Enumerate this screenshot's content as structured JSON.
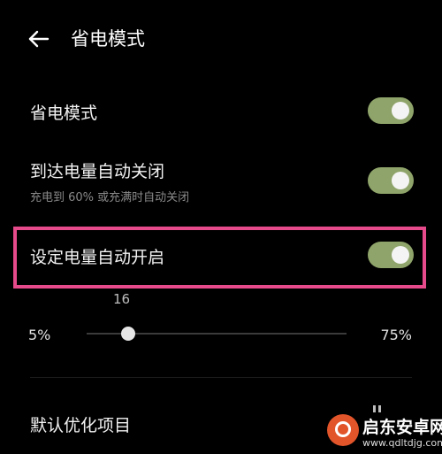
{
  "header": {
    "title": "省电模式"
  },
  "settings": [
    {
      "label": "省电模式",
      "toggle_on": true
    },
    {
      "label": "到达电量自动关闭",
      "sub": "充电到 60% 或充满时自动关闭",
      "toggle_on": true
    },
    {
      "label": "设定电量自动开启",
      "toggle_on": true
    }
  ],
  "slider": {
    "current_label": "16",
    "min_label": "5%",
    "max_label": "75%",
    "value": 16,
    "min": 5,
    "max": 75
  },
  "optimize": {
    "label": "默认优化项目"
  },
  "watermark": {
    "site_name": "启东安卓网",
    "url": "www.qdltdjg.com"
  },
  "colors": {
    "background": "#000000",
    "toggle_on": "#8fa46a",
    "highlight_border": "#e64a8a",
    "watermark_logo": "#e2542a"
  }
}
